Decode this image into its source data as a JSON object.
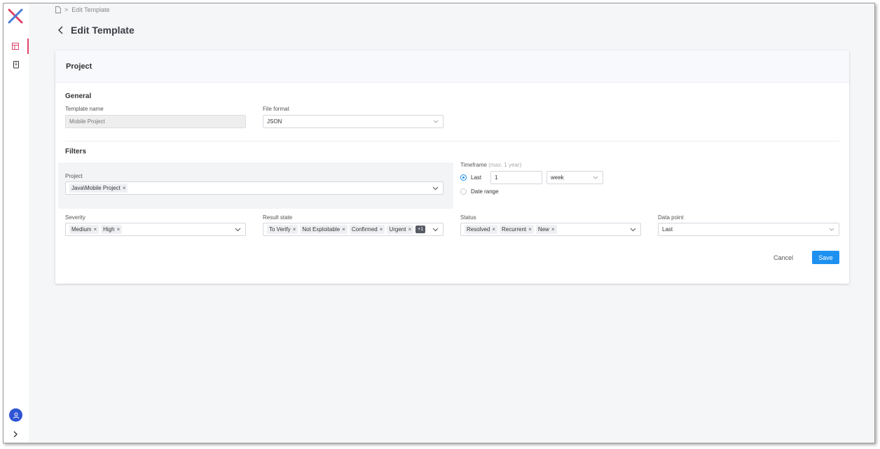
{
  "breadcrumb": {
    "icon": "file-icon",
    "separator": ">",
    "current": "Edit Template"
  },
  "header": {
    "title": "Edit Template"
  },
  "card": {
    "title": "Project"
  },
  "general": {
    "title": "General",
    "template_name": {
      "label": "Template name",
      "placeholder": "Mobile Project"
    },
    "file_format": {
      "label": "File format",
      "value": "JSON"
    }
  },
  "filters": {
    "title": "Filters",
    "project": {
      "label": "Project",
      "tags": [
        "Java\\Mobile Project"
      ]
    },
    "timeframe": {
      "label": "Timeframe",
      "hint": "(max. 1 year)",
      "last_label": "Last",
      "last_value": "1",
      "unit": "week",
      "range_label": "Date range"
    },
    "severity": {
      "label": "Severity",
      "tags": [
        "Medium",
        "High"
      ]
    },
    "result_state": {
      "label": "Result state",
      "tags": [
        "To Verify",
        "Not Exploitable",
        "Confirmed",
        "Urgent"
      ],
      "more": "+1"
    },
    "status": {
      "label": "Status",
      "tags": [
        "Resolved",
        "Recurrent",
        "New"
      ]
    },
    "data_point": {
      "label": "Data point",
      "value": "Last"
    }
  },
  "actions": {
    "cancel": "Cancel",
    "save": "Save"
  },
  "colors": {
    "accent": "#1e90f0",
    "active_nav": "#e0446a",
    "avatar": "#2f55d4"
  }
}
